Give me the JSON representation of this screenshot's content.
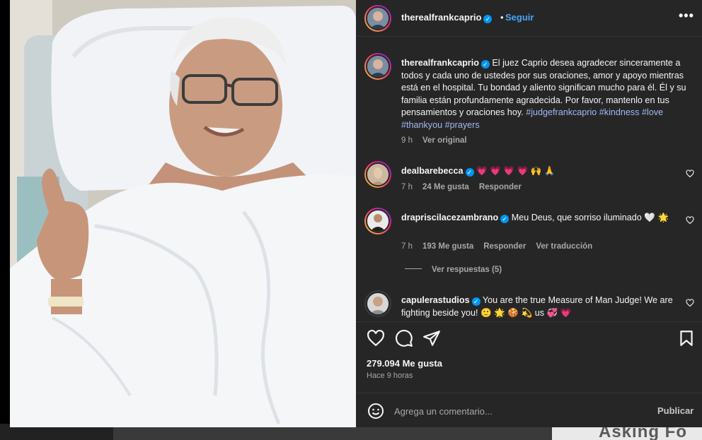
{
  "post": {
    "author": "therealfrankcaprio",
    "follow_label": "Seguir",
    "separator": "•",
    "more_label": "•••",
    "caption": {
      "author": "therealfrankcaprio",
      "text": "El juez Caprio desea agradecer sinceramente a todos y cada uno de ustedes por sus oraciones, amor y apoyo mientras está en el hospital. Tu bondad y aliento significan mucho para él. Él y su familia están profundamente agradecida. Por favor, mantenlo en tus pensamientos y oraciones hoy.",
      "hashtags": "#judgefrankcaprio #kindness #love #thankyou #prayers",
      "time": "9 h",
      "see_original": "Ver original"
    },
    "comments": [
      {
        "author": "dealbarebecca",
        "text": "💗 💗 💗 💗 🙌 🙏",
        "time": "7 h",
        "likes": "24 Me gusta",
        "reply": "Responder"
      },
      {
        "author": "draprisci lacezambrano",
        "author_display": "draprisci lacezambrano",
        "text": "Meu Deus, que sorriso iluminado 🤍 🌟",
        "time": "7 h",
        "likes": "193 Me gusta",
        "reply": "Responder",
        "translate": "Ver traducción",
        "view_replies": "Ver respuestas (5)"
      },
      {
        "author": "capulerastudios",
        "text": "You are the true Measure of Man Judge! We are fighting beside you! 🙂 🌟 🍪 💫 us 💞 💗"
      }
    ],
    "likes_count": "279.094 Me gusta",
    "time_ago": "Hace 9 horas",
    "comment_placeholder": "Agrega un comentario...",
    "publish_label": "Publicar"
  },
  "backdrop": {
    "right_text": "Asking Fo"
  },
  "colors": {
    "panel_bg": "#262626",
    "link_blue": "#4ba5f8",
    "hashtag": "#a3b8f7",
    "muted": "#a8a8a8",
    "verified": "#0095f6"
  }
}
